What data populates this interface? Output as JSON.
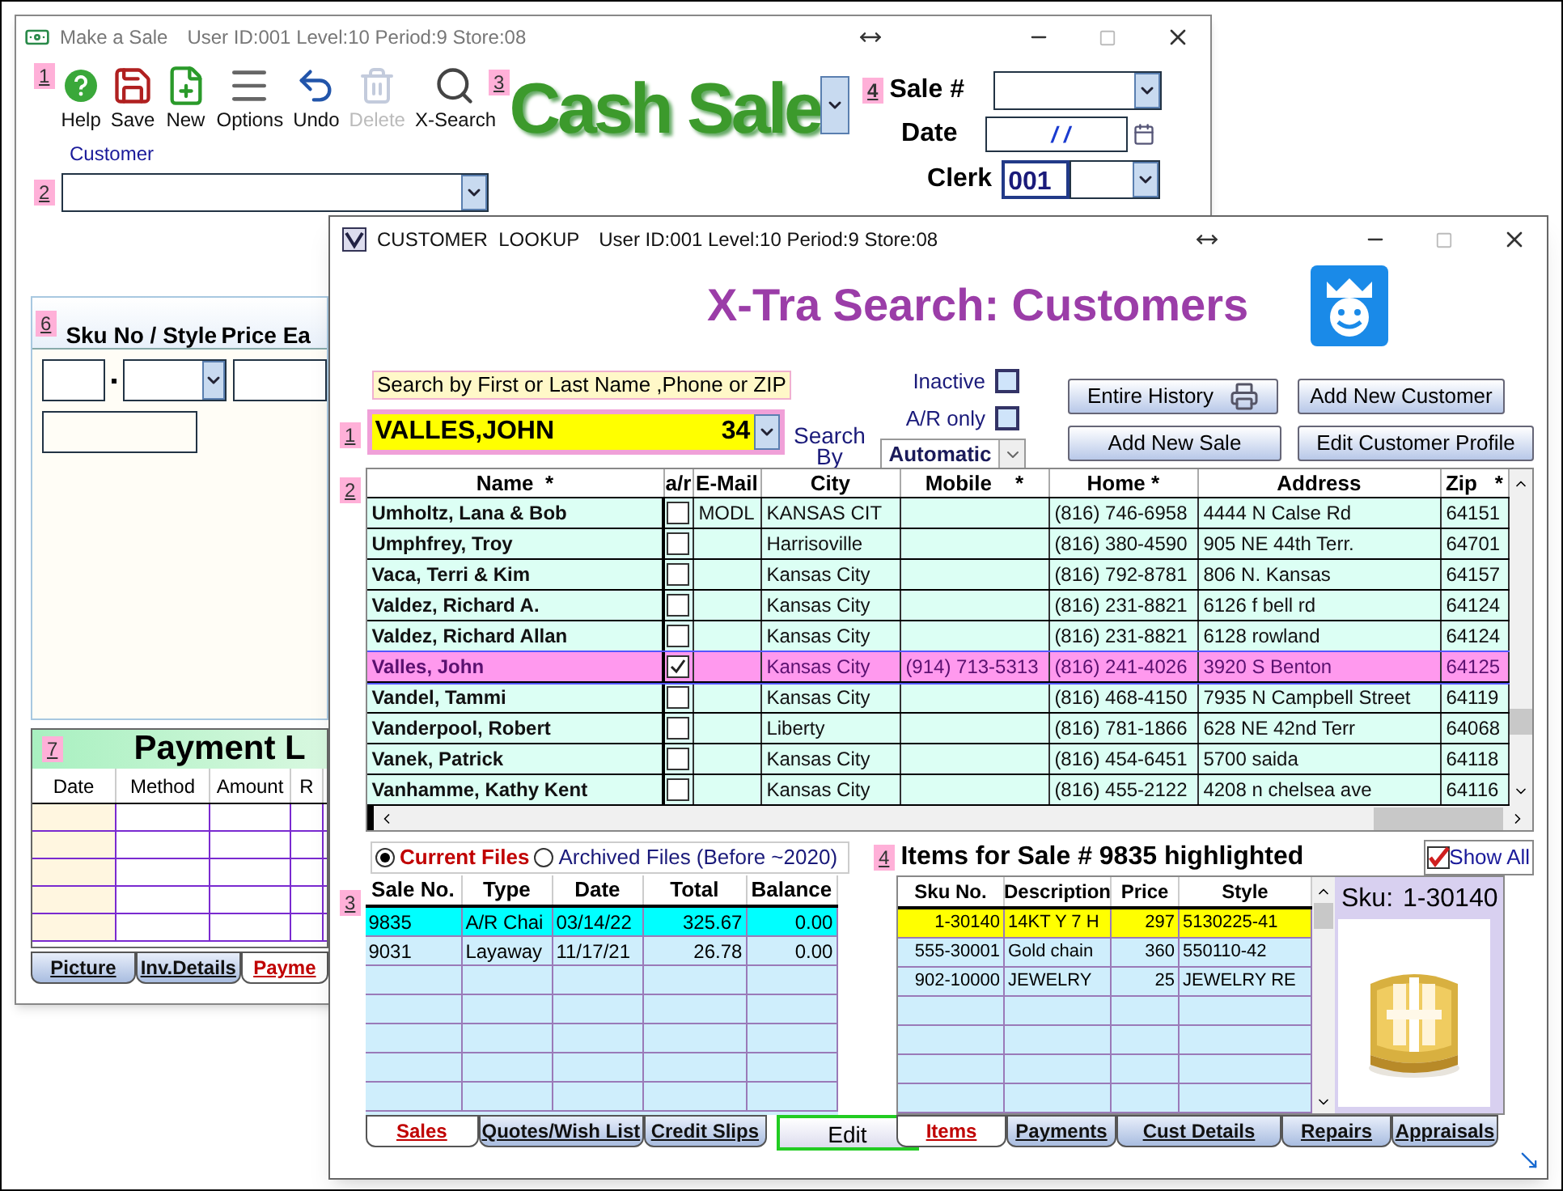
{
  "back_window": {
    "title": "Make a Sale",
    "info": "User ID:001 Level:10 Period:9 Store:08",
    "toolbar": {
      "marker": "1",
      "buttons": [
        {
          "kind": "help",
          "label": "Help",
          "disabled": false
        },
        {
          "kind": "save",
          "label": "Save",
          "disabled": false
        },
        {
          "kind": "new",
          "label": "New",
          "disabled": false
        },
        {
          "kind": "options",
          "label": "Options",
          "disabled": false
        },
        {
          "kind": "undo",
          "label": "Undo",
          "disabled": false
        },
        {
          "kind": "delete",
          "label": "Delete",
          "disabled": true
        },
        {
          "kind": "search",
          "label": "X-Search",
          "disabled": false
        }
      ]
    },
    "logo": {
      "marker": "3",
      "text": "Cash Sale"
    },
    "sale": {
      "marker": "4",
      "sale_label": "Sale #",
      "date_label": "Date",
      "date_value": "/ /",
      "clerk_label": "Clerk",
      "clerk_value": "001"
    },
    "customer": {
      "marker": "2",
      "label": "Customer"
    },
    "item_panel": {
      "marker": "6",
      "sku_label": "Sku No / Style",
      "price_label": "Price Ea"
    },
    "payment_panel": {
      "marker": "7",
      "title": "Payment L",
      "columns": [
        "Date",
        "Method",
        "Amount",
        "R"
      ]
    },
    "tabs": [
      {
        "label": "Picture",
        "selected": false
      },
      {
        "label": "Inv.Details",
        "selected": false
      },
      {
        "label": "Payme",
        "selected": true
      }
    ]
  },
  "lookup_window": {
    "title": "CUSTOMER  LOOKUP",
    "info": "User ID:001 Level:10 Period:9 Store:08",
    "heading": "X-Tra Search: Customers",
    "search": {
      "marker": "1",
      "hint": "Search by First or Last Name ,Phone or ZIP",
      "value": "VALLES,JOHN",
      "count": "34",
      "by_label": "Search By",
      "mode": "Automatic"
    },
    "filters": [
      {
        "label": "Inactive",
        "checked": false
      },
      {
        "label": "A/R only",
        "checked": false
      }
    ],
    "buttons": [
      {
        "label": "Entire History",
        "kind": "print"
      },
      {
        "label": "Add New Customer",
        "kind": "plain"
      },
      {
        "label": "Add New Sale",
        "kind": "plain"
      },
      {
        "label": "Edit Customer Profile",
        "kind": "plain"
      }
    ],
    "table": {
      "marker": "2",
      "columns": [
        "Name  *",
        "a/r",
        "E-Mail",
        "City",
        "Mobile    *",
        "Home *",
        "Address",
        "Zip   *"
      ],
      "rows": [
        {
          "name": "Umholtz, Lana & Bob",
          "ar": false,
          "email": "MODL",
          "city": "KANSAS CIT",
          "mobile": "",
          "home": "(816) 746-6958",
          "address": "4444 N Calse Rd",
          "zip": "64151",
          "selected": false
        },
        {
          "name": "Umphfrey, Troy",
          "ar": false,
          "email": "",
          "city": "Harrisoville",
          "mobile": "",
          "home": "(816) 380-4590",
          "address": "905 NE 44th Terr.",
          "zip": "64701",
          "selected": false
        },
        {
          "name": "Vaca, Terri & Kim",
          "ar": false,
          "email": "",
          "city": "Kansas City",
          "mobile": "",
          "home": "(816) 792-8781",
          "address": "806 N. Kansas",
          "zip": "64157",
          "selected": false
        },
        {
          "name": "Valdez, Richard A.",
          "ar": false,
          "email": "",
          "city": "Kansas City",
          "mobile": "",
          "home": "(816) 231-8821",
          "address": "6126 f bell rd",
          "zip": "64124",
          "selected": false
        },
        {
          "name": "Valdez, Richard Allan",
          "ar": false,
          "email": "",
          "city": "Kansas City",
          "mobile": "",
          "home": "(816) 231-8821",
          "address": "6128 rowland",
          "zip": "64124",
          "selected": false
        },
        {
          "name": "Valles, John",
          "ar": true,
          "email": "",
          "city": "Kansas City",
          "mobile": "(914) 713-5313",
          "home": "(816) 241-4026",
          "address": "3920 S Benton",
          "zip": "64125",
          "selected": true
        },
        {
          "name": "Vandel, Tammi",
          "ar": false,
          "email": "",
          "city": "Kansas City",
          "mobile": "",
          "home": "(816) 468-4150",
          "address": "7935 N Campbell Street",
          "zip": "64119",
          "selected": false
        },
        {
          "name": "Vanderpool, Robert",
          "ar": false,
          "email": "",
          "city": "Liberty",
          "mobile": "",
          "home": "(816) 781-1866",
          "address": "628 NE 42nd Terr",
          "zip": "64068",
          "selected": false
        },
        {
          "name": "Vanek, Patrick",
          "ar": false,
          "email": "",
          "city": "Kansas City",
          "mobile": "",
          "home": "(816) 454-6451",
          "address": "5700 saida",
          "zip": "64118",
          "selected": false
        },
        {
          "name": "Vanhamme, Kathy Kent",
          "ar": false,
          "email": "",
          "city": "Kansas City",
          "mobile": "",
          "home": "(816) 455-2122",
          "address": "4208 n chelsea ave",
          "zip": "64116",
          "selected": false
        }
      ]
    },
    "file_options": [
      {
        "label": "Current Files",
        "selected": true
      },
      {
        "label": "Archived Files (Before ~2020)",
        "selected": false
      }
    ],
    "sales": {
      "marker": "3",
      "columns": [
        "Sale No.",
        "Type",
        "Date",
        "Total",
        "Balance"
      ],
      "rows": [
        {
          "cells": [
            "9835",
            "A/R Chai",
            "03/14/22",
            "325.67",
            "0.00"
          ],
          "selected": true
        },
        {
          "cells": [
            "9031",
            "Layaway",
            "11/17/21",
            "26.78",
            "0.00"
          ],
          "selected": false
        }
      ]
    },
    "sales_tabs": [
      {
        "label": "Sales",
        "selected": true
      },
      {
        "label": "Quotes/Wish List",
        "selected": false
      },
      {
        "label": "Credit Slips",
        "selected": false
      }
    ],
    "edit_button": "Edit",
    "items": {
      "marker": "4",
      "title": "Items for Sale # 9835 highlighted",
      "show_all": {
        "label": "Show All",
        "checked": true
      },
      "columns": [
        "Sku No.",
        "Description",
        "Price",
        "Style"
      ],
      "rows": [
        {
          "cells": [
            "1-30140",
            "14KT Y 7 H",
            "297",
            "5130225-41"
          ],
          "selected": true
        },
        {
          "cells": [
            "555-30001",
            "Gold chain",
            "360",
            "550110-42"
          ],
          "selected": false
        },
        {
          "cells": [
            "902-10000",
            "JEWELRY",
            "25",
            "JEWELRY RE"
          ],
          "selected": false
        }
      ],
      "sku_label": "Sku:",
      "sku_value": "1-30140"
    },
    "item_tabs": [
      {
        "label": "Items",
        "selected": true
      },
      {
        "label": "Payments",
        "selected": false
      },
      {
        "label": "Cust Details",
        "selected": false
      },
      {
        "label": "Repairs",
        "selected": false
      },
      {
        "label": "Appraisals",
        "selected": false
      }
    ]
  }
}
